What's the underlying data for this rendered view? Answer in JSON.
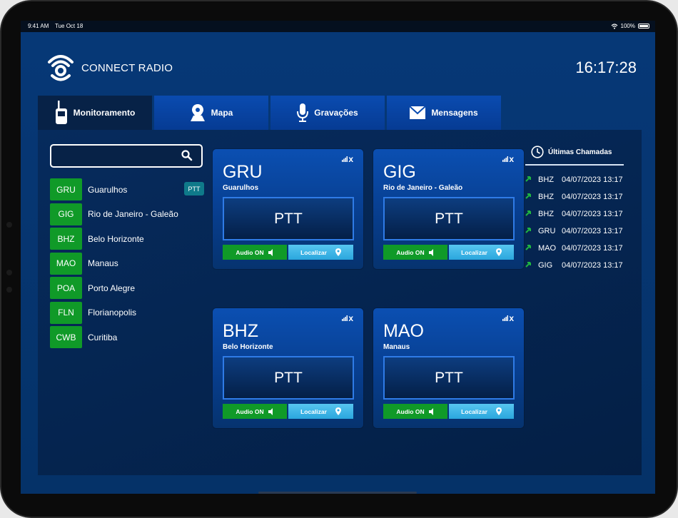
{
  "status_bar": {
    "time": "9:41 AM",
    "date": "Tue Oct 18",
    "battery": "100%"
  },
  "app": {
    "title": "CONNECT RADIO",
    "clock": "16:17:28"
  },
  "tabs": [
    {
      "label": "Monitoramento",
      "icon": "walkie-talkie-icon",
      "active": true
    },
    {
      "label": "Mapa",
      "icon": "map-pin-icon",
      "active": false
    },
    {
      "label": "Gravações",
      "icon": "microphone-icon",
      "active": false
    },
    {
      "label": "Mensagens",
      "icon": "envelope-icon",
      "active": false
    }
  ],
  "search": {
    "value": "",
    "placeholder": ""
  },
  "stations": [
    {
      "code": "GRU",
      "name": "Guarulhos",
      "badge": "PTT"
    },
    {
      "code": "GIG",
      "name": "Rio de Janeiro - Galeão"
    },
    {
      "code": "BHZ",
      "name": "Belo Horizonte"
    },
    {
      "code": "MAO",
      "name": "Manaus"
    },
    {
      "code": "POA",
      "name": "Porto Alegre"
    },
    {
      "code": "FLN",
      "name": "Florianopolis"
    },
    {
      "code": "CWB",
      "name": "Curitiba"
    }
  ],
  "cards": [
    {
      "code": "GRU",
      "name": "Guarulhos",
      "ptt": "PTT",
      "audio": "Audio ON",
      "locate": "Localizar",
      "close": "x"
    },
    {
      "code": "GIG",
      "name": "Rio de Janeiro - Galeão",
      "ptt": "PTT",
      "audio": "Audio ON",
      "locate": "Localizar",
      "close": "x"
    },
    {
      "code": "BHZ",
      "name": "Belo Horizonte",
      "ptt": "PTT",
      "audio": "Audio ON",
      "locate": "Localizar",
      "close": "x"
    },
    {
      "code": "MAO",
      "name": "Manaus",
      "ptt": "PTT",
      "audio": "Audio ON",
      "locate": "Localizar",
      "close": "x"
    }
  ],
  "recent_calls": {
    "title": "Últimas Chamadas",
    "calls": [
      {
        "code": "BHZ",
        "datetime": "04/07/2023 13:17"
      },
      {
        "code": "BHZ",
        "datetime": "04/07/2023 13:17"
      },
      {
        "code": "BHZ",
        "datetime": "04/07/2023 13:17"
      },
      {
        "code": "GRU",
        "datetime": "04/07/2023 13:17"
      },
      {
        "code": "MAO",
        "datetime": "04/07/2023 13:17"
      },
      {
        "code": "GIG",
        "datetime": "04/07/2023 13:17"
      }
    ]
  },
  "colors": {
    "background": "#053268",
    "tab": "#0a4bb0",
    "tab_active": "#072247",
    "station_green": "#109a28",
    "locate_blue": "#2aa6dd",
    "ptt_badge": "#0f7a8a"
  }
}
